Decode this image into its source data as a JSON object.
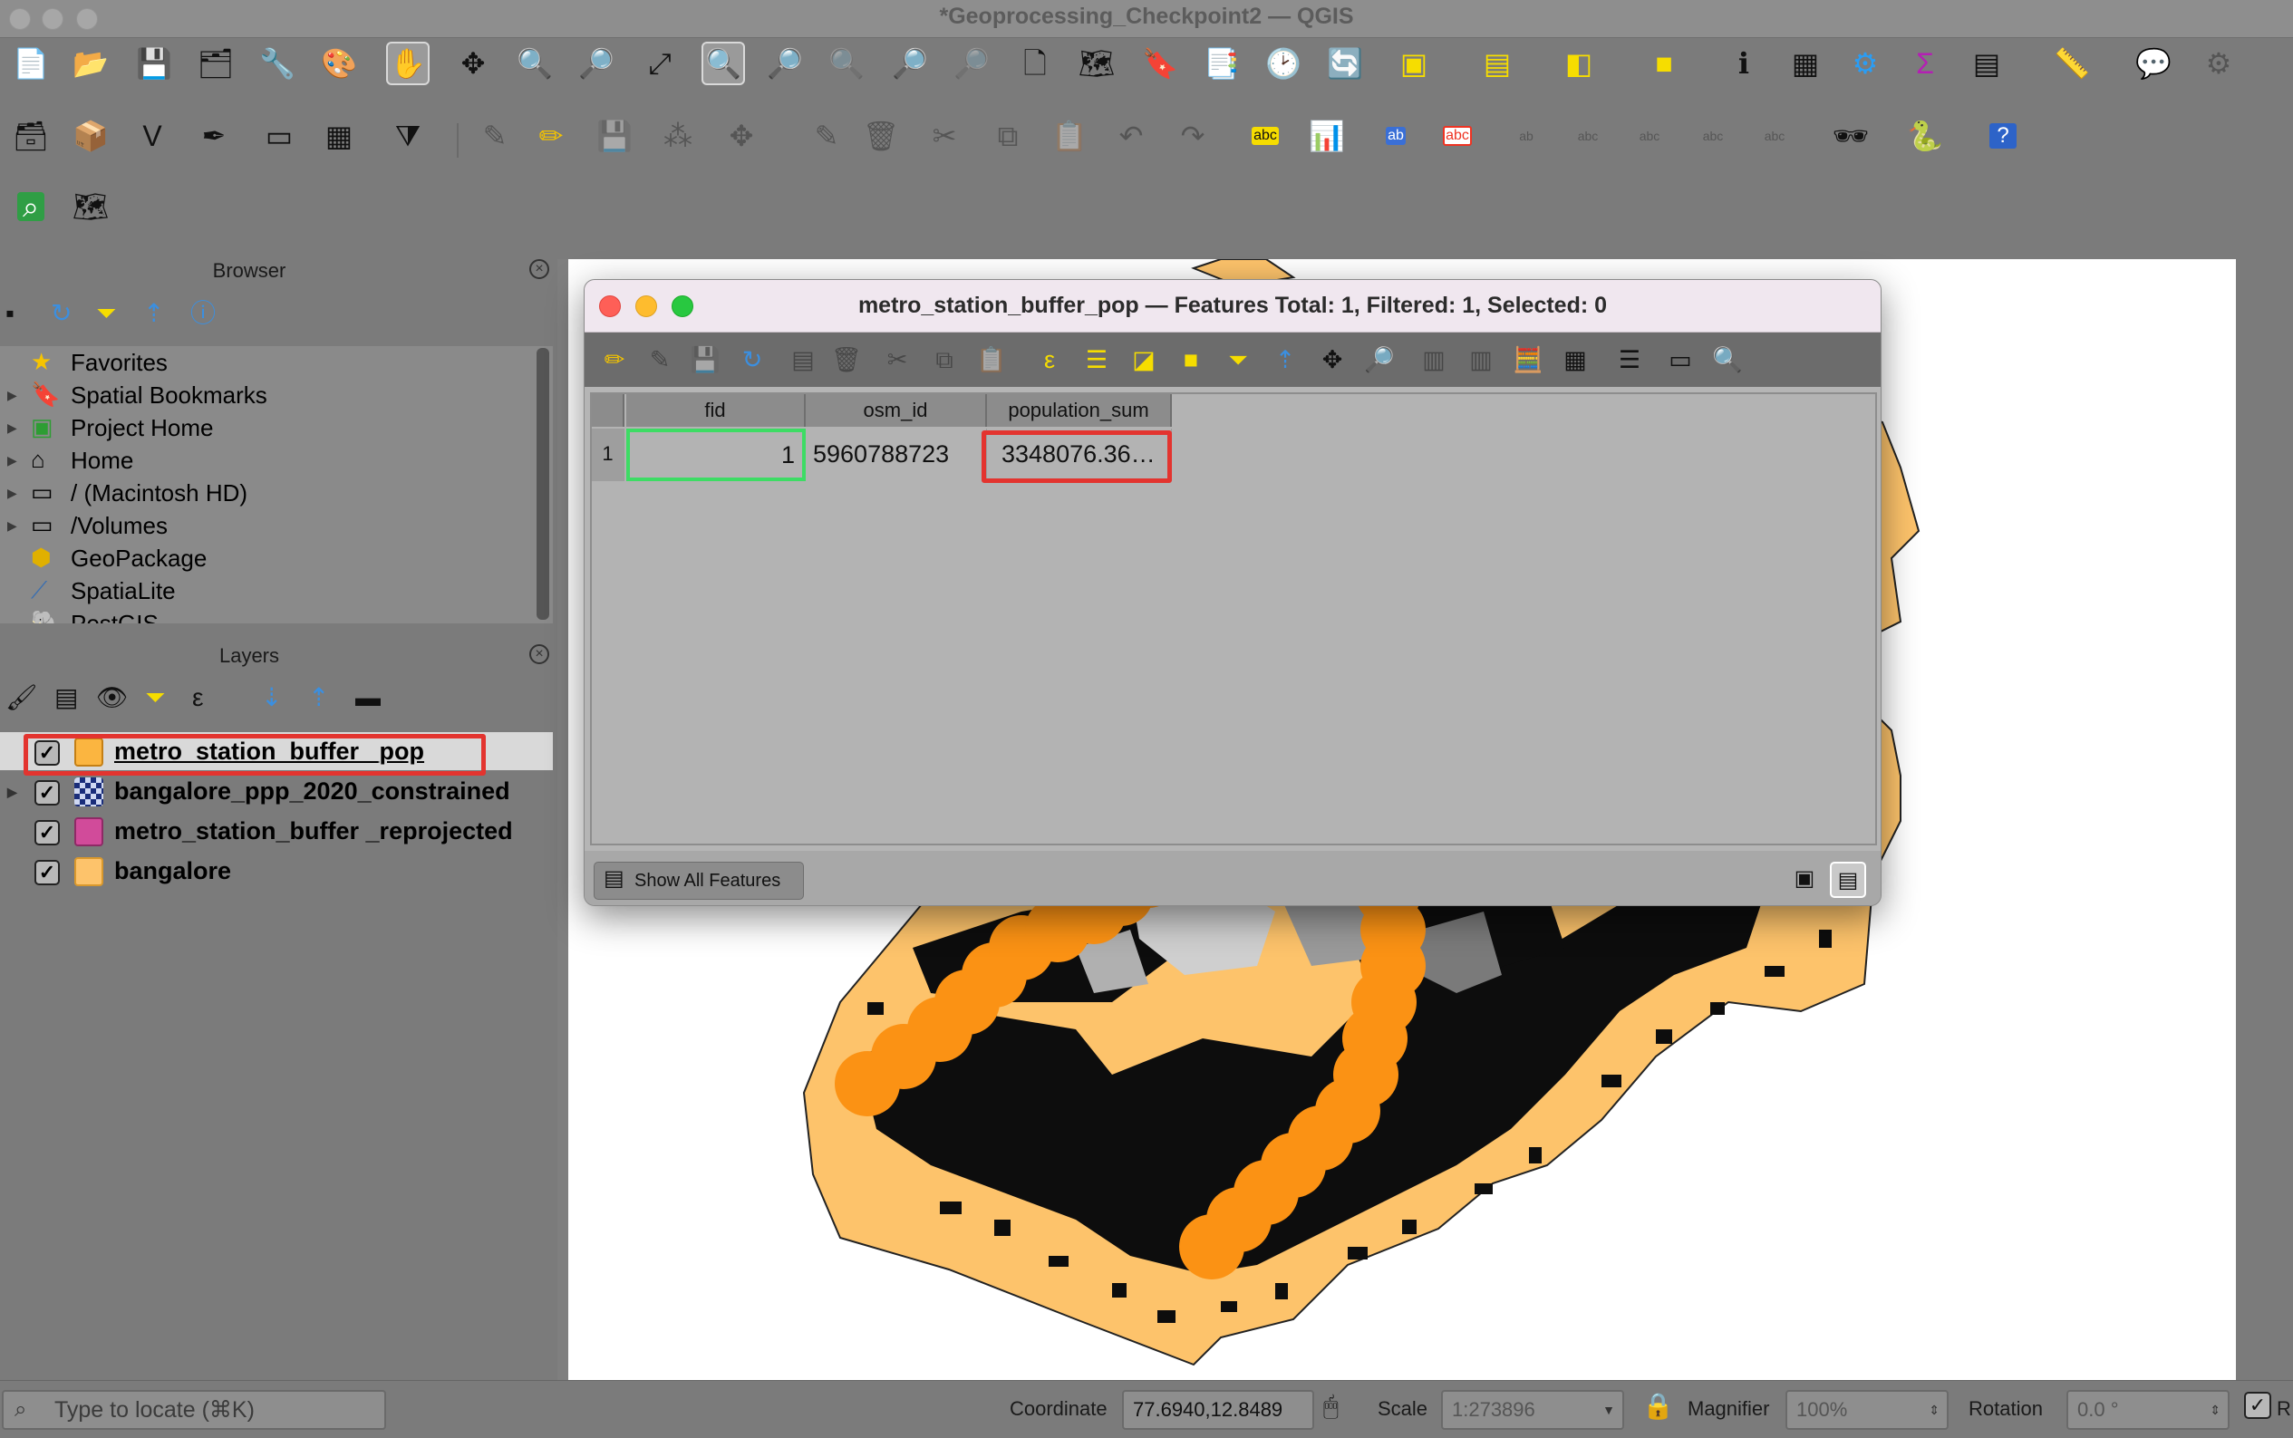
{
  "window": {
    "title": "*Geoprocessing_Checkpoint2 — QGIS"
  },
  "toolbar": {
    "row1_icons": [
      "new-project-icon",
      "open-project-icon",
      "save-project-icon",
      "print-layout-icon",
      "layout-manager-icon",
      "style-manager-icon",
      "pan-icon",
      "pan-to-selection-icon",
      "zoom-in-icon",
      "zoom-out-icon",
      "zoom-full-icon",
      "zoom-to-selection-icon",
      "zoom-to-layer-icon",
      "zoom-native-icon",
      "zoom-last-icon",
      "zoom-next-icon",
      "new-map-view-icon",
      "new-3d-view-icon",
      "new-bookmark-icon",
      "show-bookmarks-icon",
      "temporal-controller-icon",
      "refresh-icon",
      "select-features-icon",
      "select-by-value-icon",
      "deselect-icon",
      "select-location-icon",
      "identify-icon",
      "attribute-table-icon",
      "toolbox-icon",
      "statistics-icon",
      "open-table-icon",
      "measure-icon",
      "annotation-icon",
      "settings-icon"
    ],
    "row2_icons": [
      "data-source-manager-icon",
      "new-geopackage-icon",
      "new-vertex-layer-icon",
      "digitize-icon",
      "new-virtual-layer-icon",
      "new-temp-layer-icon",
      "vertex-tool-icon",
      "current-edits-icon",
      "toggle-editing-icon",
      "save-edits-icon",
      "add-point-icon",
      "move-feature-icon",
      "node-tool-icon",
      "delete-selected-icon",
      "cut-icon",
      "copy-icon",
      "paste-icon",
      "undo-icon",
      "redo-icon",
      "label-icon",
      "diagram-icon",
      "pin-label-icon",
      "highlight-label-icon",
      "show-label-icon",
      "move-label-icon",
      "rotate-label-icon",
      "change-label-icon",
      "label-props-icon",
      "plugin-icon",
      "python-icon",
      "help-icon"
    ],
    "row3_icons": [
      "locator-search-icon",
      "plugin-extra-icon"
    ]
  },
  "browser": {
    "title": "Browser",
    "items": [
      {
        "label": "Favorites",
        "icon": "star-icon",
        "expandable": false
      },
      {
        "label": "Spatial Bookmarks",
        "icon": "bookmark-icon",
        "expandable": true
      },
      {
        "label": "Project Home",
        "icon": "project-home-icon",
        "expandable": true
      },
      {
        "label": "Home",
        "icon": "home-icon",
        "expandable": true
      },
      {
        "label": "/ (Macintosh HD)",
        "icon": "folder-icon",
        "expandable": true
      },
      {
        "label": "/Volumes",
        "icon": "folder-icon",
        "expandable": true
      },
      {
        "label": "GeoPackage",
        "icon": "geopackage-icon",
        "expandable": false
      },
      {
        "label": "SpatiaLite",
        "icon": "spatialite-icon",
        "expandable": false
      },
      {
        "label": "PostGIS",
        "icon": "postgis-icon",
        "expandable": false
      }
    ]
  },
  "layers": {
    "title": "Layers",
    "items": [
      {
        "label": "metro_station_buffer _pop",
        "color": "#fbb540",
        "checked": true,
        "selected": true
      },
      {
        "label": "bangalore_ppp_2020_constrained",
        "color": "raster",
        "checked": true,
        "selected": false
      },
      {
        "label": "metro_station_buffer _reprojected",
        "color": "#d14b9a",
        "checked": true,
        "selected": false
      },
      {
        "label": "bangalore",
        "color": "#fdc36b",
        "checked": true,
        "selected": false
      }
    ]
  },
  "attribute_table": {
    "title": "metro_station_buffer_pop — Features Total: 1, Filtered: 1, Selected: 0",
    "columns": [
      "fid",
      "osm_id",
      "population_sum"
    ],
    "rows": [
      {
        "row_number": "1",
        "fid": "1",
        "osm_id": "5960788723",
        "population_sum": "3348076.36…"
      }
    ],
    "show_all_label": "Show All Features"
  },
  "statusbar": {
    "locator_placeholder": "Type to locate (⌘K)",
    "coordinate_label": "Coordinate",
    "coordinate_value": "77.6940,12.8489",
    "scale_label": "Scale",
    "scale_value": "1:273896",
    "magnifier_label": "Magnifier",
    "magnifier_value": "100%",
    "rotation_label": "Rotation",
    "rotation_value": "0.0 °",
    "render_label": "R"
  },
  "colors": {
    "buffer_orange": "#fb9214",
    "bangalore_fill": "#fdc36b",
    "highlight_red": "#e3342f",
    "cell_focus_green": "#3ddc64"
  }
}
